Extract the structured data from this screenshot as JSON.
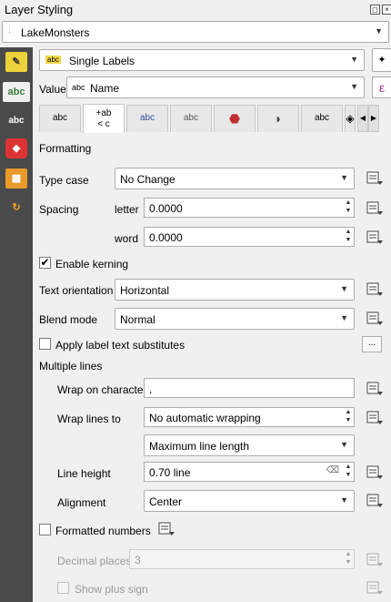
{
  "panel": {
    "title": "Layer Styling"
  },
  "layer_select": {
    "value": "LakeMonsters"
  },
  "label_mode": {
    "value": "Single Labels"
  },
  "value_field": {
    "label": "Value",
    "expr": "Name",
    "prefix": "abc",
    "epsilon": "ε"
  },
  "tabs": [
    "abc",
    "+ab<c",
    "abc",
    "abc",
    "",
    "",
    "abc",
    ""
  ],
  "formatting": {
    "header": "Formatting",
    "type_case": {
      "label": "Type case",
      "value": "No Change"
    },
    "spacing": {
      "label": "Spacing",
      "letter_label": "letter",
      "letter_value": "0.0000",
      "word_label": "word",
      "word_value": "0.0000"
    },
    "enable_kerning": {
      "label": "Enable kerning",
      "checked": true
    },
    "text_orientation": {
      "label": "Text orientation",
      "value": "Horizontal"
    },
    "blend_mode": {
      "label": "Blend mode",
      "value": "Normal"
    },
    "substitutes": {
      "label": "Apply label text substitutes",
      "button": "..."
    },
    "multiple_lines": {
      "header": "Multiple lines",
      "wrap_char_label": "Wrap on character",
      "wrap_char_value": ",",
      "wrap_lines_label": "Wrap lines to",
      "wrap_lines_value": "No automatic wrapping",
      "wrap_mode_value": "Maximum line length",
      "line_height_label": "Line height",
      "line_height_value": "0.70 line",
      "alignment_label": "Alignment",
      "alignment_value": "Center"
    },
    "formatted_numbers": {
      "label": "Formatted numbers",
      "decimal_label": "Decimal places",
      "decimal_value": "3",
      "plus_label": "Show plus sign"
    }
  }
}
